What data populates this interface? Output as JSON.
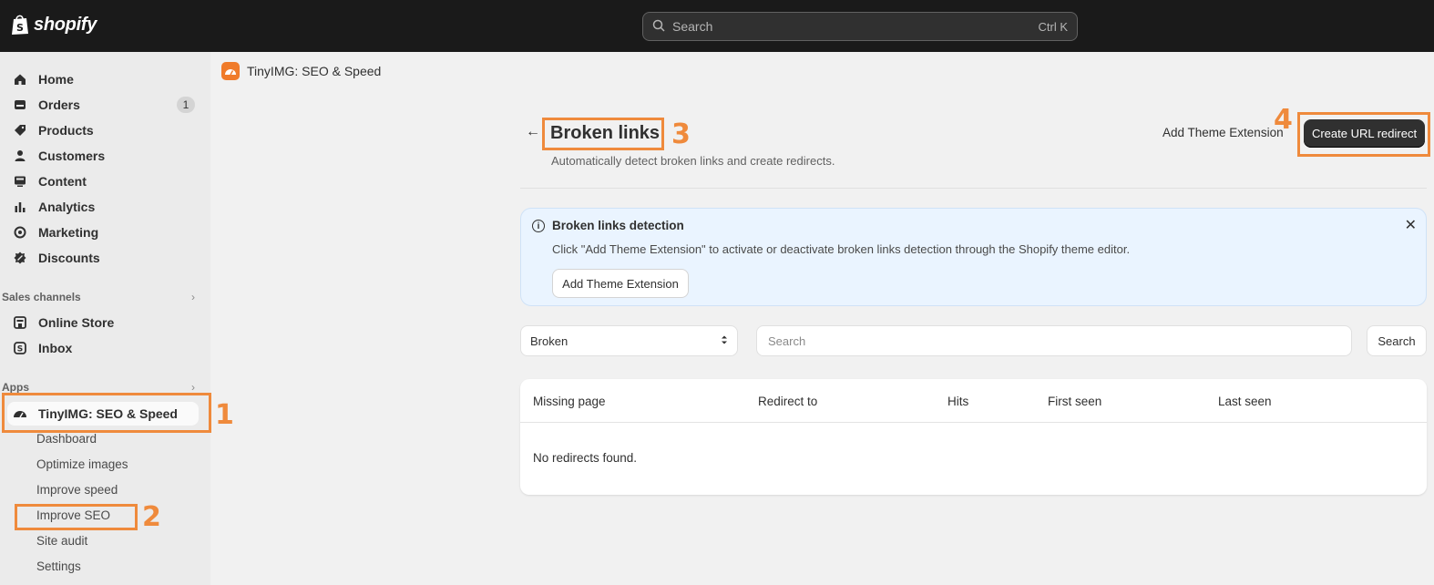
{
  "topbar": {
    "brand": "shopify",
    "search_placeholder": "Search",
    "search_shortcut": "Ctrl K"
  },
  "sidebar": {
    "items": [
      {
        "label": "Home",
        "icon": "home-icon"
      },
      {
        "label": "Orders",
        "icon": "orders-icon",
        "badge": "1"
      },
      {
        "label": "Products",
        "icon": "tag-icon"
      },
      {
        "label": "Customers",
        "icon": "person-icon"
      },
      {
        "label": "Content",
        "icon": "content-icon"
      },
      {
        "label": "Analytics",
        "icon": "bar-chart-icon"
      },
      {
        "label": "Marketing",
        "icon": "target-icon"
      },
      {
        "label": "Discounts",
        "icon": "discount-icon"
      }
    ],
    "sales_channels_label": "Sales channels",
    "channels": [
      {
        "label": "Online Store",
        "icon": "store-icon"
      },
      {
        "label": "Inbox",
        "icon": "inbox-icon"
      }
    ],
    "apps_label": "Apps",
    "app": {
      "label": "TinyIMG: SEO & Speed",
      "icon": "speedometer-icon"
    },
    "app_subitems": [
      "Dashboard",
      "Optimize images",
      "Improve speed",
      "Improve SEO",
      "Site audit",
      "Settings"
    ]
  },
  "annotations": [
    "1",
    "2",
    "3",
    "4"
  ],
  "main": {
    "app_name": "TinyIMG: SEO & Speed",
    "title": "Broken links",
    "subtitle": "Automatically detect broken links and create redirects.",
    "secondary_action": "Add Theme Extension",
    "primary_action": "Create URL redirect",
    "banner": {
      "title": "Broken links detection",
      "text": "Click \"Add Theme Extension\" to activate or deactivate broken links detection through the Shopify theme editor.",
      "button": "Add Theme Extension"
    },
    "filter": {
      "selected": "Broken",
      "search_placeholder": "Search",
      "search_button": "Search"
    },
    "table": {
      "columns": [
        "Missing page",
        "Redirect to",
        "Hits",
        "First seen",
        "Last seen"
      ],
      "empty": "No redirects found."
    }
  },
  "colors": {
    "annotation": "#ef8a3c",
    "topbar": "#1a1a1a",
    "primary_button": "#303030",
    "banner_bg": "#eaf4ff"
  }
}
